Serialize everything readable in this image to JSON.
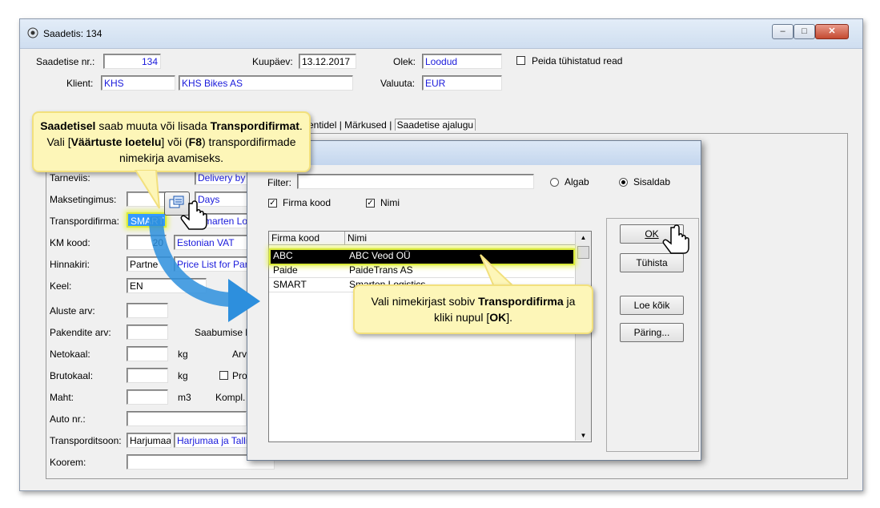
{
  "window": {
    "title": "Saadetis: 134",
    "controls": {
      "minimize": "–",
      "maximize": "□",
      "close": "✕"
    }
  },
  "header": {
    "saadetise_nr_label": "Saadetise nr.:",
    "saadetise_nr_value": "134",
    "kuupaev_label": "Kuupäev:",
    "kuupaev_value": "13.12.2017",
    "olek_label": "Olek:",
    "olek_value": "Loodud",
    "peida_label": "Peida tühistatud read",
    "klient_label": "Klient:",
    "klient_code": "KHS",
    "klient_name": "KHS Bikes AS",
    "valuuta_label": "Valuuta:",
    "valuuta_value": "EUR"
  },
  "tabs": [
    "entidel",
    "Märkused",
    "Saadetise ajalugu"
  ],
  "form": {
    "tarneviis_label": "Tarneviis:",
    "tarneviis_value": "Delivery by Waves",
    "maksetingimus_label": "Maksetingimus:",
    "maksetingimus_value": "Days",
    "transpordifirma_label": "Transpordifirma:",
    "transpordifirma_code": "SMART",
    "transpordifirma_name": "Smarten Logistics",
    "km_kood_label": "KM kood:",
    "km_kood_code": "20",
    "km_kood_name": "Estonian VAT",
    "hinnakiri_label": "Hinnakiri:",
    "hinnakiri_code": "Partne",
    "hinnakiri_name": "Price List for Par",
    "keel_label": "Keel:",
    "keel_value": "EN",
    "aluste_label": "Aluste arv:",
    "pakendite_label": "Pakendite arv:",
    "saabumise_label": "Saabumise k",
    "netokaal_label": "Netokaal:",
    "netokaal_unit": "kg",
    "arv_label": "Arv",
    "brutokaal_label": "Brutokaal:",
    "brutokaal_unit": "kg",
    "pro_label": "Pro",
    "maht_label": "Maht:",
    "maht_unit": "m3",
    "kompl_label": "Kompl.",
    "auto_label": "Auto nr.:",
    "transporditsoon_label": "Transporditsoon:",
    "transporditsoon_code": "Harjumaa",
    "transporditsoon_name": "Harjumaa ja Talli",
    "koorem_label": "Koorem:"
  },
  "dialog": {
    "filter_label": "Filter:",
    "filter_value": "",
    "algab_label": "Algab",
    "sisaldab_label": "Sisaldab",
    "firma_kood_check": "Firma kood",
    "nimi_check": "Nimi",
    "columns": [
      "Firma kood",
      "Nimi"
    ],
    "rows": [
      {
        "code": "ABC",
        "name": "ABC Veod OÜ",
        "selected": true
      },
      {
        "code": "Paide",
        "name": "PaideTrans AS",
        "selected": false
      },
      {
        "code": "SMART",
        "name": "Smarten Logistics",
        "selected": false
      }
    ],
    "ok_label": "OK",
    "tuhista_label": "Tühista",
    "loe_koik_label": "Loe kõik",
    "paring_label": "Päring..."
  },
  "callouts": {
    "top": {
      "b1": "Saadetisel",
      "t1": " saab muuta või lisada ",
      "b2": "Transpordifirmat",
      "t2": ". Vali [",
      "b3": "Väärtuste loetelu",
      "t3": "] või (",
      "b4": "F8",
      "t4": ") transpordifirmade nimekirja avamiseks."
    },
    "bottom": {
      "t1": "Vali nimekirjast sobiv ",
      "b1": "Transpordifirma",
      "t2": " ja kliki nupul [",
      "b2": "OK",
      "t3": "]."
    }
  },
  "colors": {
    "accent": "#1a1adb",
    "selection": "#000000",
    "highlight": "#d9ea3a",
    "callout": "#fdf6b8",
    "arrow": "#2d8fdd"
  }
}
